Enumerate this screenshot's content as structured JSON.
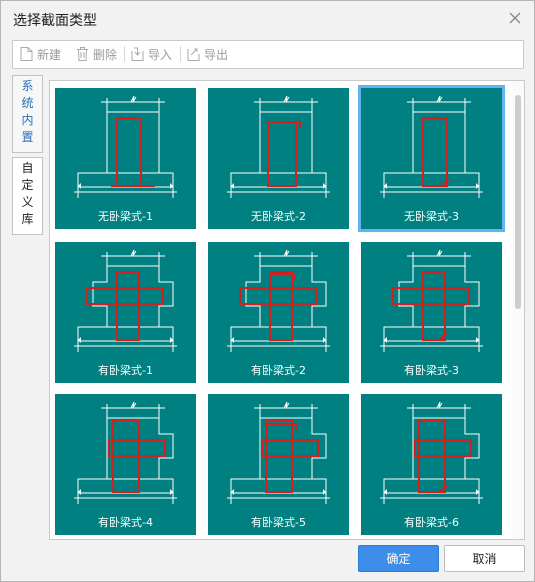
{
  "dialog": {
    "title": "选择截面类型"
  },
  "toolbar": {
    "new_label": "新建",
    "delete_label": "删除",
    "import_label": "导入",
    "export_label": "导出"
  },
  "tabs": [
    {
      "label": "系统内置",
      "chars": [
        "系",
        "统",
        "内",
        "置"
      ],
      "active": true
    },
    {
      "label": "自定义库",
      "chars": [
        "自",
        "定",
        "义",
        "库"
      ],
      "active": false
    }
  ],
  "cards": [
    {
      "label": "无卧梁式-1",
      "kind": "plain",
      "rebar": 1,
      "selected": false
    },
    {
      "label": "无卧梁式-2",
      "kind": "plain",
      "rebar": 2,
      "selected": false
    },
    {
      "label": "无卧梁式-3",
      "kind": "plain",
      "rebar": 3,
      "selected": true
    },
    {
      "label": "有卧梁式-1",
      "kind": "cross",
      "rebar": 1,
      "selected": false
    },
    {
      "label": "有卧梁式-2",
      "kind": "cross",
      "rebar": 2,
      "selected": false
    },
    {
      "label": "有卧梁式-3",
      "kind": "cross",
      "rebar": 3,
      "selected": false
    },
    {
      "label": "有卧梁式-4",
      "kind": "side",
      "rebar": 1,
      "selected": false
    },
    {
      "label": "有卧梁式-5",
      "kind": "side",
      "rebar": 2,
      "selected": false
    },
    {
      "label": "有卧梁式-6",
      "kind": "side",
      "rebar": 3,
      "selected": false
    }
  ],
  "buttons": {
    "ok_label": "确定",
    "cancel_label": "取消"
  },
  "colors": {
    "card_bg": "#008080",
    "outline": "#ffffff",
    "rebar": "#d41f1f",
    "selected_border": "#63b3ee",
    "primary": "#3c8ee8",
    "tab_active_text": "#2b6fb8"
  },
  "icons": {
    "close": "close-icon",
    "new": "new-file-icon",
    "delete": "trash-icon",
    "import": "import-icon",
    "export": "export-icon"
  }
}
